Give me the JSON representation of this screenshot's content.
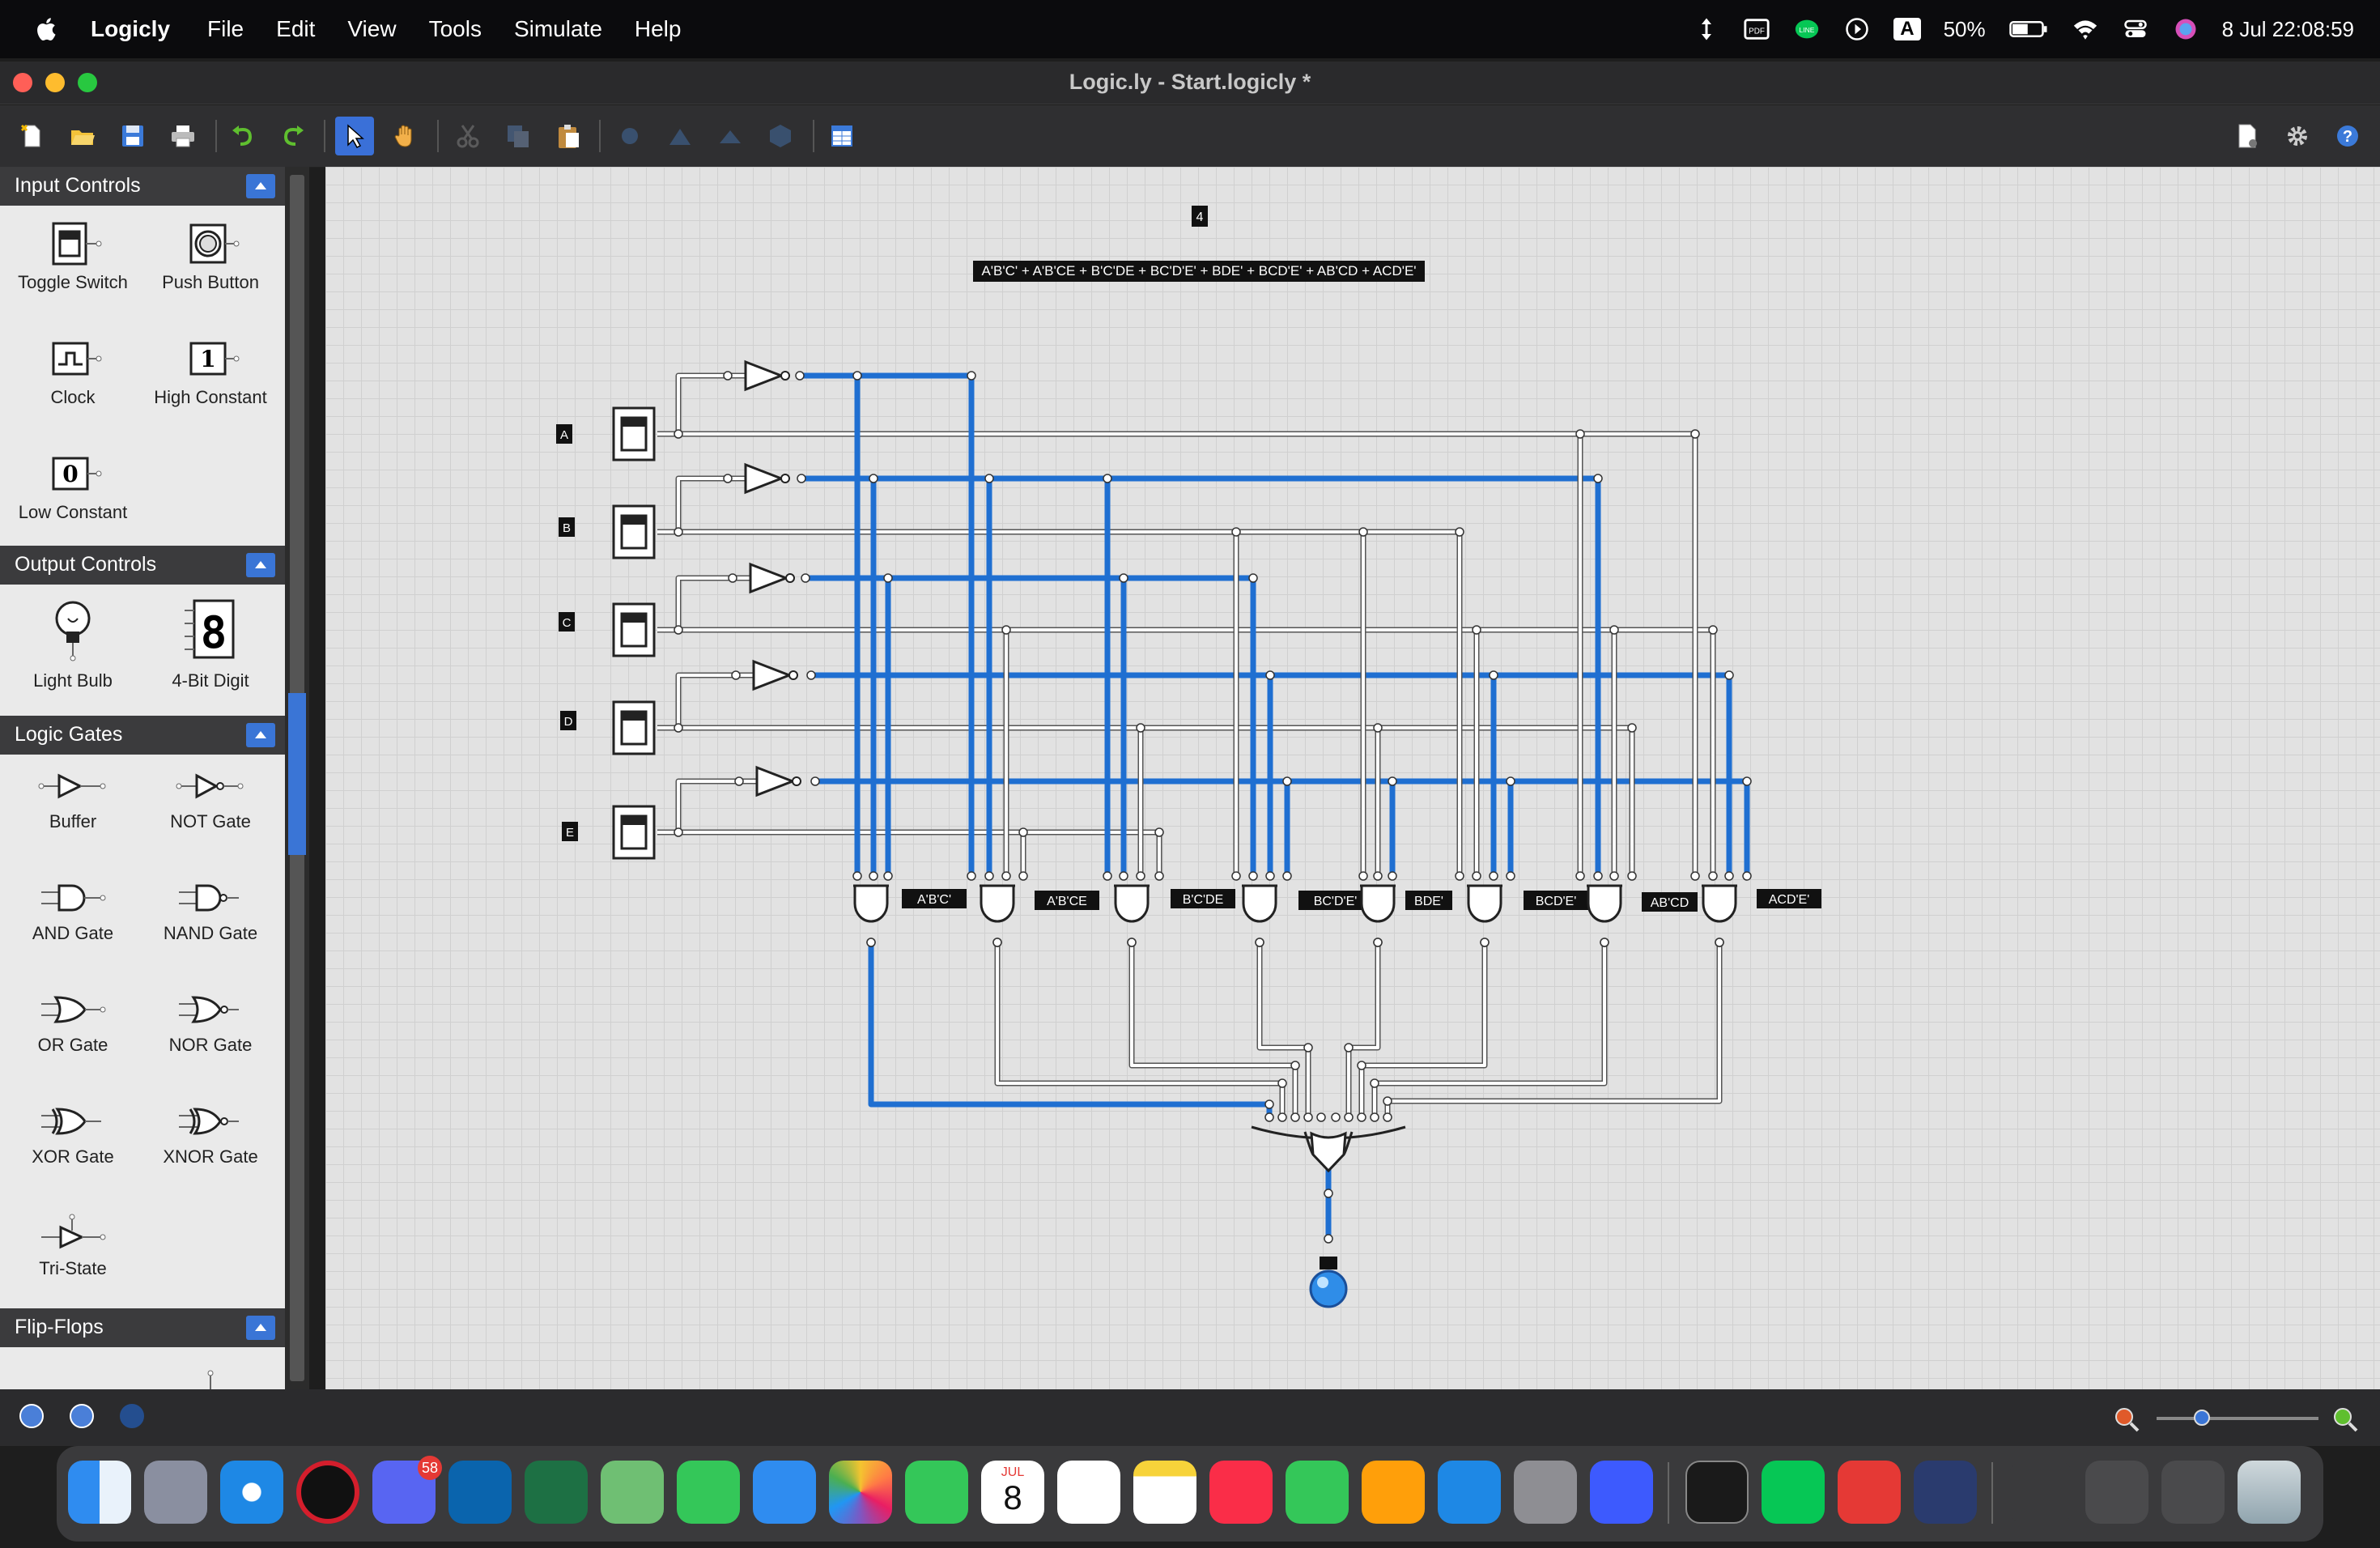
{
  "menubar": {
    "app_name": "Logicly",
    "menus": [
      "File",
      "Edit",
      "View",
      "Tools",
      "Simulate",
      "Help"
    ],
    "battery": "50%",
    "datetime": "8 Jul  22:08:59",
    "input_source": "A"
  },
  "window": {
    "title": "Logic.ly - Start.logicly *"
  },
  "sidebar": {
    "categories": [
      {
        "title": "Input Controls",
        "items": [
          "Toggle Switch",
          "Push Button",
          "Clock",
          "High Constant",
          "Low Constant"
        ]
      },
      {
        "title": "Output Controls",
        "items": [
          "Light Bulb",
          "4-Bit Digit"
        ]
      },
      {
        "title": "Logic Gates",
        "items": [
          "Buffer",
          "NOT Gate",
          "AND Gate",
          "NAND Gate",
          "OR Gate",
          "NOR Gate",
          "XOR Gate",
          "XNOR Gate",
          "Tri-State"
        ]
      },
      {
        "title": "Flip-Flops",
        "items": []
      }
    ]
  },
  "circuit": {
    "counter_label": "4",
    "expression": "A'B'C' + A'B'CE + B'C'DE + BC'D'E' + BDE' + BCD'E' + AB'CD + ACD'E'",
    "inputs": [
      "A",
      "B",
      "C",
      "D",
      "E"
    ],
    "terms": [
      "A'B'C'",
      "A'B'CE",
      "B'C'DE",
      "BC'D'E'",
      "BDE'",
      "BCD'E'",
      "AB'CD",
      "ACD'E'"
    ]
  },
  "dock": {
    "discord_badge": "58",
    "calendar_month": "JUL",
    "calendar_day": "8"
  },
  "colors": {
    "wire_active": "#1f6fd1",
    "wire_idle": "#ffffff",
    "accent": "#3a75d6"
  }
}
